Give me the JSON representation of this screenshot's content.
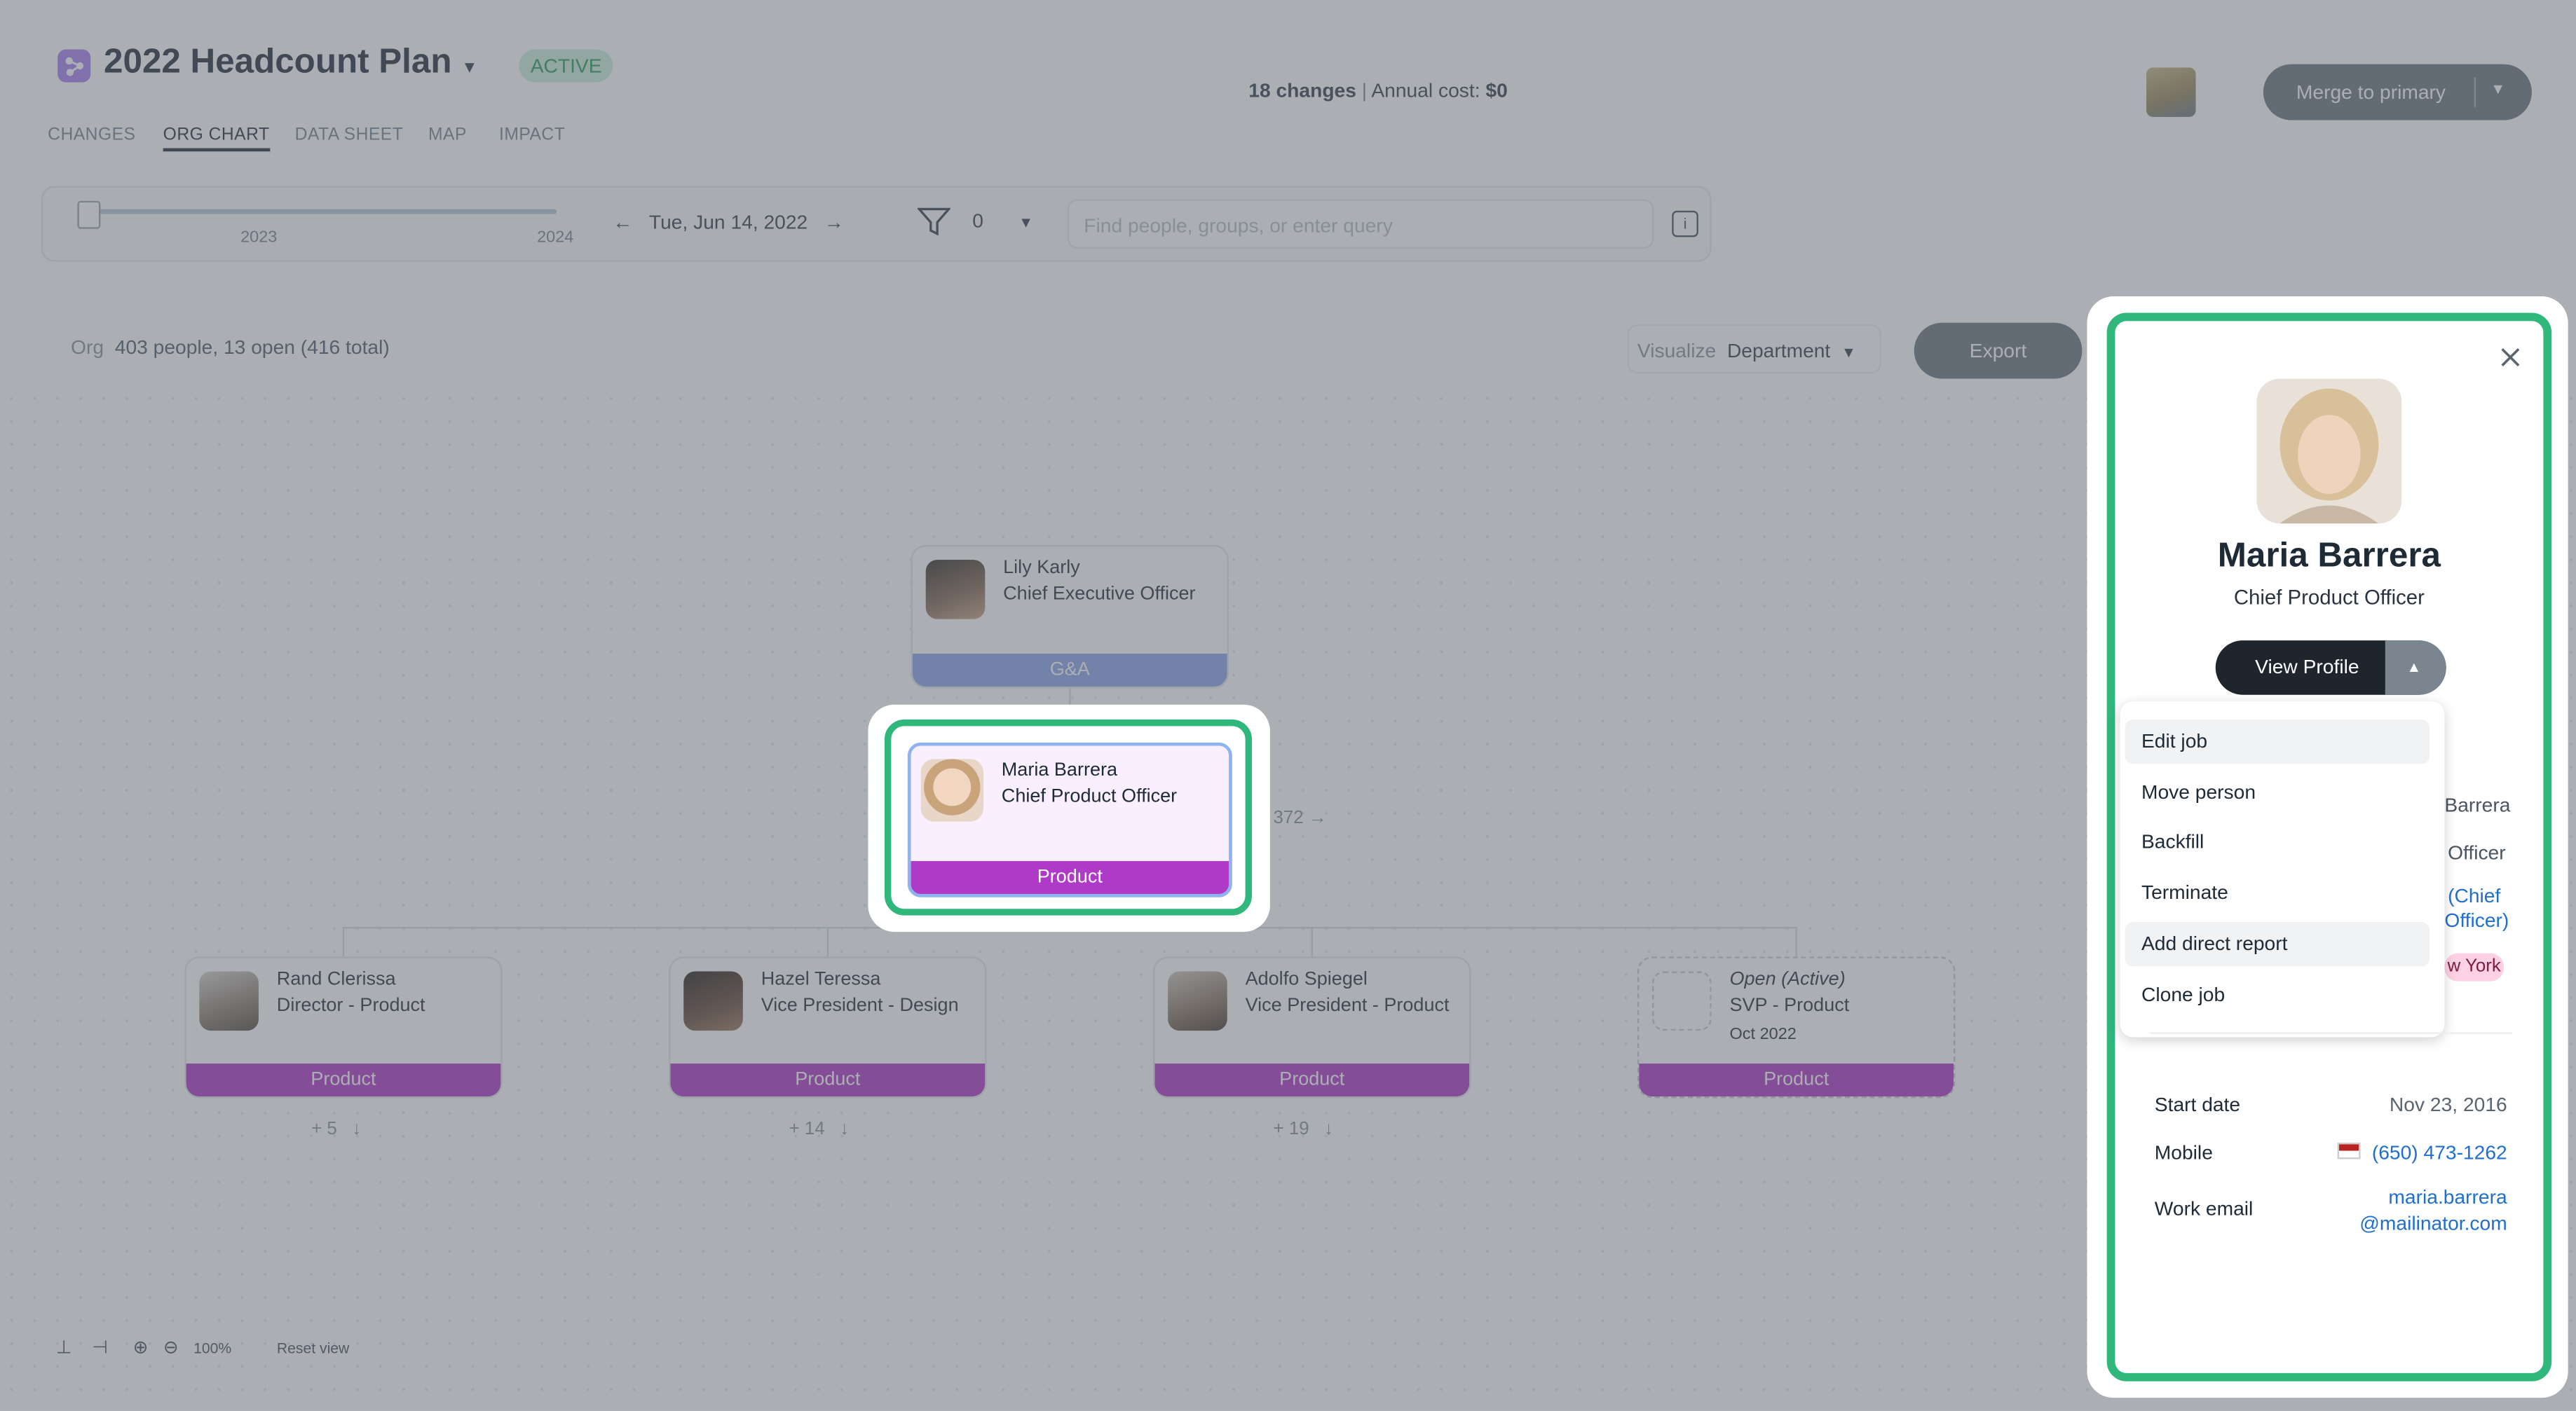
{
  "header": {
    "plan_title": "2022 Headcount Plan",
    "status_badge": "ACTIVE",
    "tabs": [
      "CHANGES",
      "ORG CHART",
      "DATA SHEET",
      "MAP",
      "IMPACT"
    ],
    "selected_tab": "ORG CHART",
    "changes_count": "18 changes",
    "annual_cost_label": "Annual cost:",
    "annual_cost_value": "$0",
    "merge_button": "Merge to primary"
  },
  "toolbar": {
    "year_start": "2023",
    "year_end": "2024",
    "date": "Tue, Jun 14, 2022",
    "filter_count": "0",
    "search_placeholder": "Find people, groups, or enter query"
  },
  "org_bar": {
    "label": "Org",
    "count": "403 people, 13 open (416 total)",
    "visualize_label": "Visualize",
    "visualize_value": "Department",
    "export_button": "Export"
  },
  "org_chart": {
    "root": {
      "name": "Lily Karly",
      "title": "Chief Executive Officer",
      "department": "G&A"
    },
    "selected": {
      "name": "Maria Barrera",
      "title": "Chief Product Officer",
      "department": "Product",
      "reports_count": "372"
    },
    "reports": [
      {
        "name": "Rand Clerissa",
        "title": "Director - Product",
        "department": "Product",
        "count": "+ 5"
      },
      {
        "name": "Hazel Teressa",
        "title": "Vice President - Design",
        "department": "Product",
        "count": "+ 14"
      },
      {
        "name": "Adolfo Spiegel",
        "title": "Vice President - Product",
        "department": "Product",
        "count": "+ 19"
      },
      {
        "name": "Open (Active)",
        "title": "SVP - Product",
        "date": "Oct 2022",
        "department": "Product"
      }
    ]
  },
  "zoom": {
    "level": "100%",
    "reset": "Reset view"
  },
  "panel": {
    "name": "Maria Barrera",
    "title": "Chief Product Officer",
    "view_profile_button": "View Profile",
    "menu": [
      "Edit job",
      "Move person",
      "Backfill",
      "Terminate",
      "Add direct report",
      "Clone job"
    ],
    "peek": {
      "line1": "Barrera",
      "line2": "Officer",
      "line3a": "(Chief",
      "line3b": "Officer)",
      "location": "w York"
    },
    "details": {
      "start_date_label": "Start date",
      "start_date": "Nov 23, 2016",
      "mobile_label": "Mobile",
      "mobile": "(650) 473-1262",
      "work_email_label": "Work email",
      "work_email_line1": "maria.barrera",
      "work_email_line2": "@mailinator.com"
    }
  },
  "colors": {
    "accent_green": "#2fb77c",
    "product_purple": "#b03ac8",
    "ga_blue": "#8fa5e8",
    "link_blue": "#1f6fd1"
  }
}
